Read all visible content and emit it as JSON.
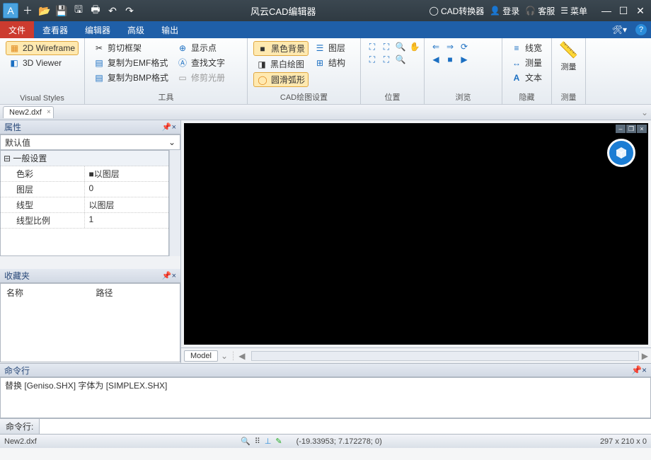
{
  "app": {
    "title": "风云CAD编辑器"
  },
  "titlebar_right": [
    {
      "icon": "◯",
      "label": "CAD转换器"
    },
    {
      "icon": "👤",
      "label": "登录"
    },
    {
      "icon": "🎧",
      "label": "客服"
    },
    {
      "icon": "☰",
      "label": "菜单"
    }
  ],
  "menu_tabs": [
    "文件",
    "查看器",
    "编辑器",
    "高级",
    "输出"
  ],
  "active_tab": 0,
  "ribbon": {
    "visual_styles": {
      "label": "Visual Styles",
      "items": [
        "2D Wireframe",
        "3D Viewer"
      ]
    },
    "tools": {
      "label": "工具",
      "items": [
        "剪切框架",
        "复制为EMF格式",
        "复制为BMP格式"
      ]
    },
    "tools2": {
      "items": [
        "显示点",
        "查找文字",
        "修剪光册"
      ]
    },
    "cad_draw": {
      "label": "CAD绘图设置",
      "col1": [
        "黑色背景",
        "黑白绘图",
        "圆滑弧形"
      ],
      "col2": [
        "图层",
        "结构"
      ]
    },
    "position": {
      "label": "位置"
    },
    "browse": {
      "label": "浏览"
    },
    "hide": {
      "label": "隐藏",
      "items": [
        "线宽",
        "测量",
        "文本"
      ]
    },
    "measure": {
      "label": "测量"
    }
  },
  "file_tabs": [
    {
      "name": "New2.dxf"
    }
  ],
  "properties": {
    "title": "属性",
    "preset": "默认值",
    "category": "一般设置",
    "rows": [
      {
        "k": "色彩",
        "v": "■以图层"
      },
      {
        "k": "图层",
        "v": "0"
      },
      {
        "k": "线型",
        "v": "以图层"
      },
      {
        "k": "线型比例",
        "v": "1"
      }
    ]
  },
  "favorites": {
    "title": "收藏夹",
    "col1": "名称",
    "col2": "路径"
  },
  "model_tab": "Model",
  "cmd": {
    "title": "命令行",
    "log": "替换 [Geniso.SHX] 字体为 [SIMPLEX.SHX]",
    "prompt": "命令行:"
  },
  "status": {
    "left": "New2.dxf",
    "coords": "(-19.33953; 7.172278; 0)",
    "size": "297 x 210 x 0"
  }
}
